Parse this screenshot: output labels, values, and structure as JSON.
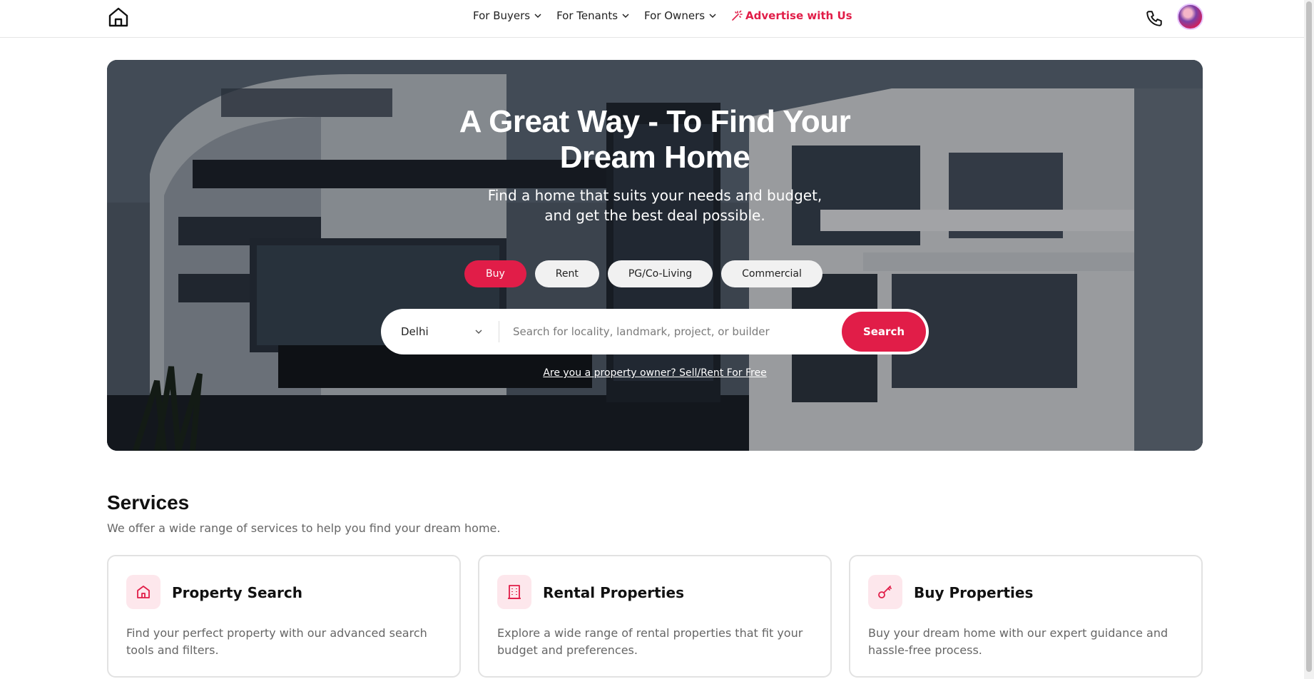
{
  "header": {
    "nav": [
      {
        "label": "For Buyers",
        "icon": "chevron-down-icon"
      },
      {
        "label": "For Tenants",
        "icon": "chevron-down-icon"
      },
      {
        "label": "For Owners",
        "icon": "chevron-down-icon"
      }
    ],
    "advertise_label": "Advertise with Us",
    "accent_color": "#e11d48"
  },
  "hero": {
    "title": "A Great Way - To Find Your Dream Home",
    "subtitle": "Find a home that suits your needs and budget, and get the best deal possible.",
    "tabs": [
      {
        "label": "Buy",
        "active": true
      },
      {
        "label": "Rent",
        "active": false
      },
      {
        "label": "PG/Co-Living",
        "active": false
      },
      {
        "label": "Commercial",
        "active": false
      }
    ],
    "search": {
      "city": "Delhi",
      "placeholder": "Search for locality, landmark, project, or builder",
      "button_label": "Search"
    },
    "owner_link": "Are you a property owner? Sell/Rent For Free"
  },
  "services": {
    "title": "Services",
    "subtitle": "We offer a wide range of services to help you find your dream home.",
    "cards": [
      {
        "title": "Property Search",
        "description": "Find your perfect property with our advanced search tools and filters.",
        "icon": "home-icon"
      },
      {
        "title": "Rental Properties",
        "description": "Explore a wide range of rental properties that fit your budget and preferences.",
        "icon": "building-icon"
      },
      {
        "title": "Buy Properties",
        "description": "Buy your dream home with our expert guidance and hassle-free process.",
        "icon": "key-icon"
      }
    ]
  }
}
